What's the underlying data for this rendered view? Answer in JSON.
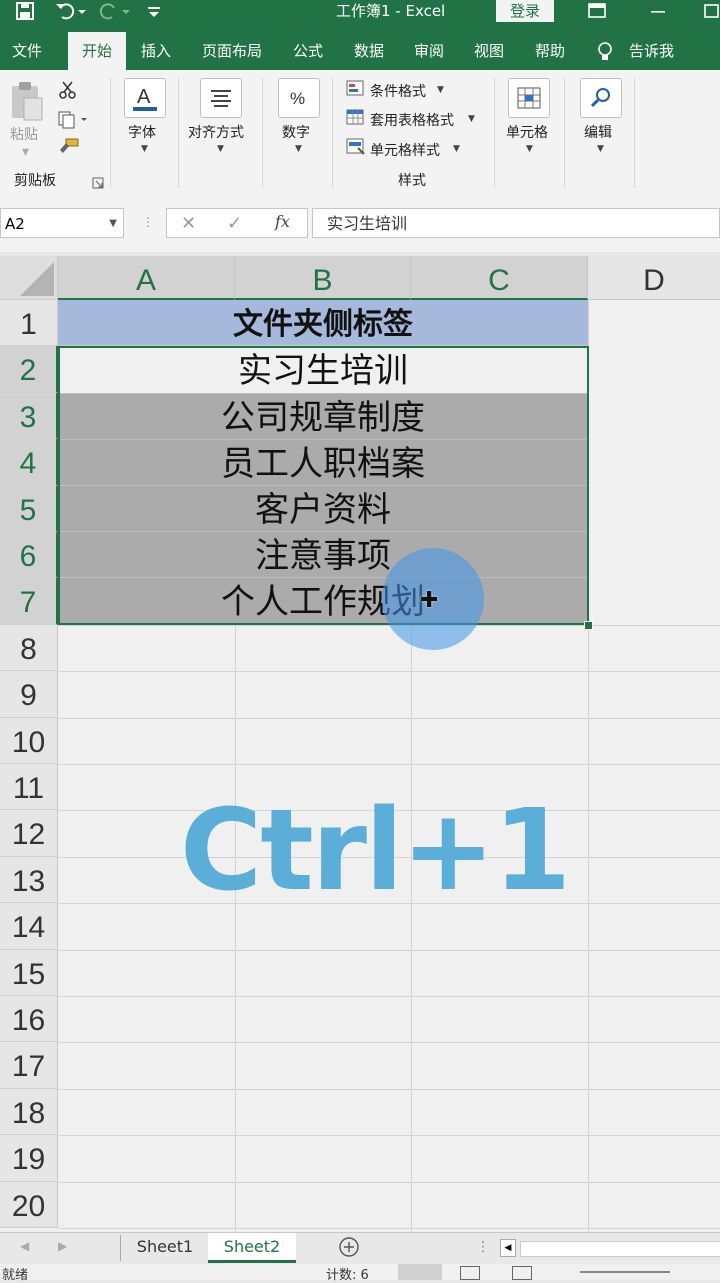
{
  "window": {
    "title": "工作簿1 - Excel",
    "login": "登录"
  },
  "menu": {
    "items": [
      "文件",
      "开始",
      "插入",
      "页面布局",
      "公式",
      "数据",
      "审阅",
      "视图",
      "帮助",
      "告诉我"
    ]
  },
  "ribbon": {
    "clipboard": {
      "paste": "粘贴",
      "group": "剪贴板"
    },
    "font": "字体",
    "align": "对齐方式",
    "number": "数字",
    "styles": {
      "cond": "条件格式",
      "table": "套用表格格式",
      "cell": "单元格样式",
      "group": "样式"
    },
    "cells": "单元格",
    "edit": "编辑"
  },
  "formula_bar": {
    "namebox": "A2",
    "fx": "fx",
    "content": "实习生培训"
  },
  "sheet": {
    "columns": [
      "A",
      "B",
      "C",
      "D"
    ],
    "rows": [
      "1",
      "2",
      "3",
      "4",
      "5",
      "6",
      "7",
      "8",
      "9",
      "10",
      "11",
      "12",
      "13",
      "14",
      "15",
      "16",
      "17",
      "18",
      "19",
      "20"
    ],
    "header": "文件夹侧标签",
    "labels": [
      "实习生培训",
      "公司规章制度",
      "员工人职档案",
      "客户资料",
      "注意事项",
      "个人工作规划"
    ],
    "header_fill": "#a6b9dc",
    "selected_fill": "#ababab"
  },
  "overlay": {
    "shortcut": "Ctrl+1",
    "cursor_color": "#4096eb",
    "shortcut_color": "#5aaed8"
  },
  "tabs": {
    "sheets": [
      "Sheet1",
      "Sheet2"
    ],
    "active": "Sheet2"
  },
  "status": {
    "ready": "就绪",
    "count": "计数: 6"
  },
  "accent": "#217346"
}
